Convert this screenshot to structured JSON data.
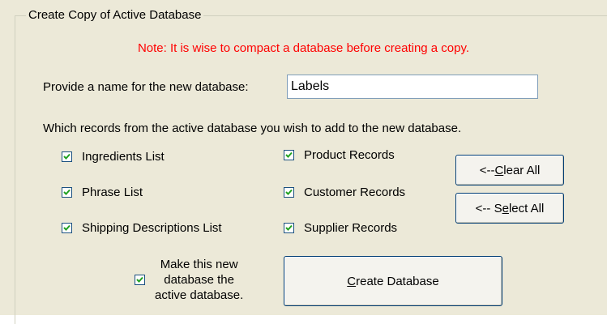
{
  "group_title": "Create Copy of Active Database",
  "note": "Note: It is wise to compact a database before creating a copy.",
  "name_label": "Provide a name for the new database:",
  "name_value": "Labels",
  "records_prompt": "Which records from the active database you wish to add to the new database.",
  "checkboxes": {
    "ingredients": {
      "label": "Ingredients List",
      "checked": true
    },
    "phrase": {
      "label": "Phrase List",
      "checked": true
    },
    "shipping": {
      "label": "Shipping Descriptions List",
      "checked": true
    },
    "product": {
      "label": "Product Records",
      "checked": true
    },
    "customer": {
      "label": "Customer Records",
      "checked": true
    },
    "supplier": {
      "label": "Supplier Records",
      "checked": true
    }
  },
  "clear_all": {
    "prefix": "<-- ",
    "accel": "C",
    "rest": "lear All"
  },
  "select_all": {
    "prefix": "<-- S",
    "accel": "e",
    "rest": "lect All"
  },
  "make_active": {
    "line1": "Make this new",
    "line2": "database the",
    "line3": "active database.",
    "checked": true
  },
  "create_button": {
    "prefix": "",
    "accel": "C",
    "rest": "reate Database"
  }
}
